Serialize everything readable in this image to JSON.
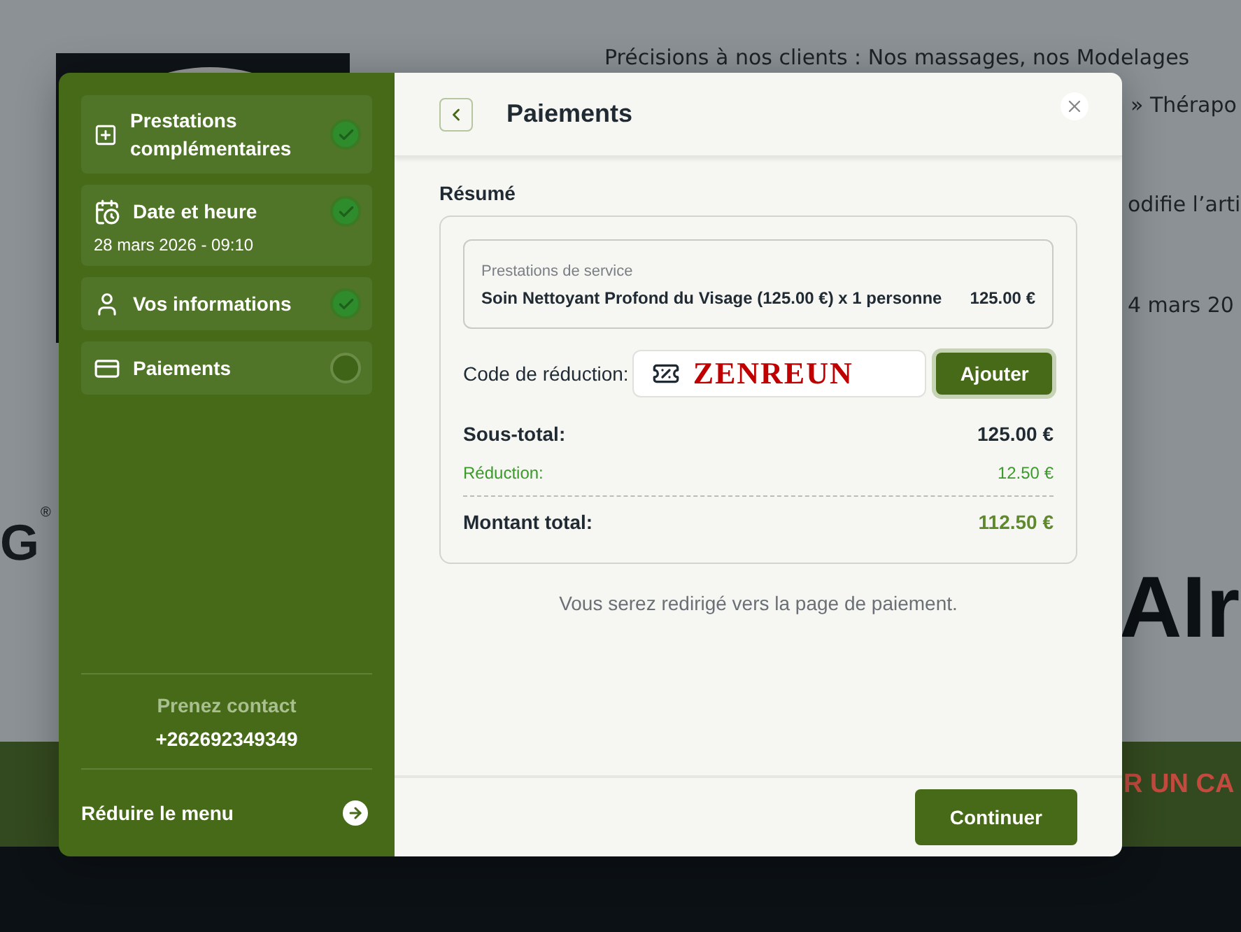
{
  "background": {
    "texts": [
      {
        "kind": "line1",
        "text": "Précisions à nos clients : Nos massages, nos Modelages"
      },
      {
        "kind": "line2",
        "text": "»  Thérapo"
      },
      {
        "kind": "line3",
        "text": "odifie l’arti"
      },
      {
        "kind": "line4",
        "text": "4 mars 20"
      }
    ],
    "logo_text": "G",
    "registered": "®",
    "brand_text": "AIr",
    "banner_text": "R UN CA"
  },
  "sidebar": {
    "steps": [
      {
        "label": "Prestations complémentaires",
        "completed": true
      },
      {
        "label": "Date et heure",
        "detail": "28 mars 2026 - 09:10",
        "completed": true
      },
      {
        "label": "Vos informations",
        "completed": true
      },
      {
        "label": "Paiements",
        "completed": false
      }
    ],
    "contact": {
      "title": "Prenez contact",
      "phone": "+262692349349"
    },
    "collapse": "Réduire le menu"
  },
  "dialog": {
    "title": "Paiements",
    "section": "Résumé",
    "service": {
      "heading": "Prestations de service",
      "line": "Soin Nettoyant Profond du Visage (125.00 €) x 1 personne",
      "amount": "125.00 €"
    },
    "discount": {
      "label": "Code de réduction:",
      "value": "ZENREUN",
      "button": "Ajouter"
    },
    "totals": [
      {
        "kind": "subtotal",
        "label": "Sous-total:",
        "amount": "125.00 €"
      },
      {
        "kind": "discount",
        "label": "Réduction:",
        "amount": "12.50 €"
      },
      {
        "kind": "total",
        "label": "Montant total:",
        "amount": "112.50 €"
      }
    ],
    "note": "Vous serez redirigé vers la page de paiement.",
    "continue": "Continuer"
  }
}
